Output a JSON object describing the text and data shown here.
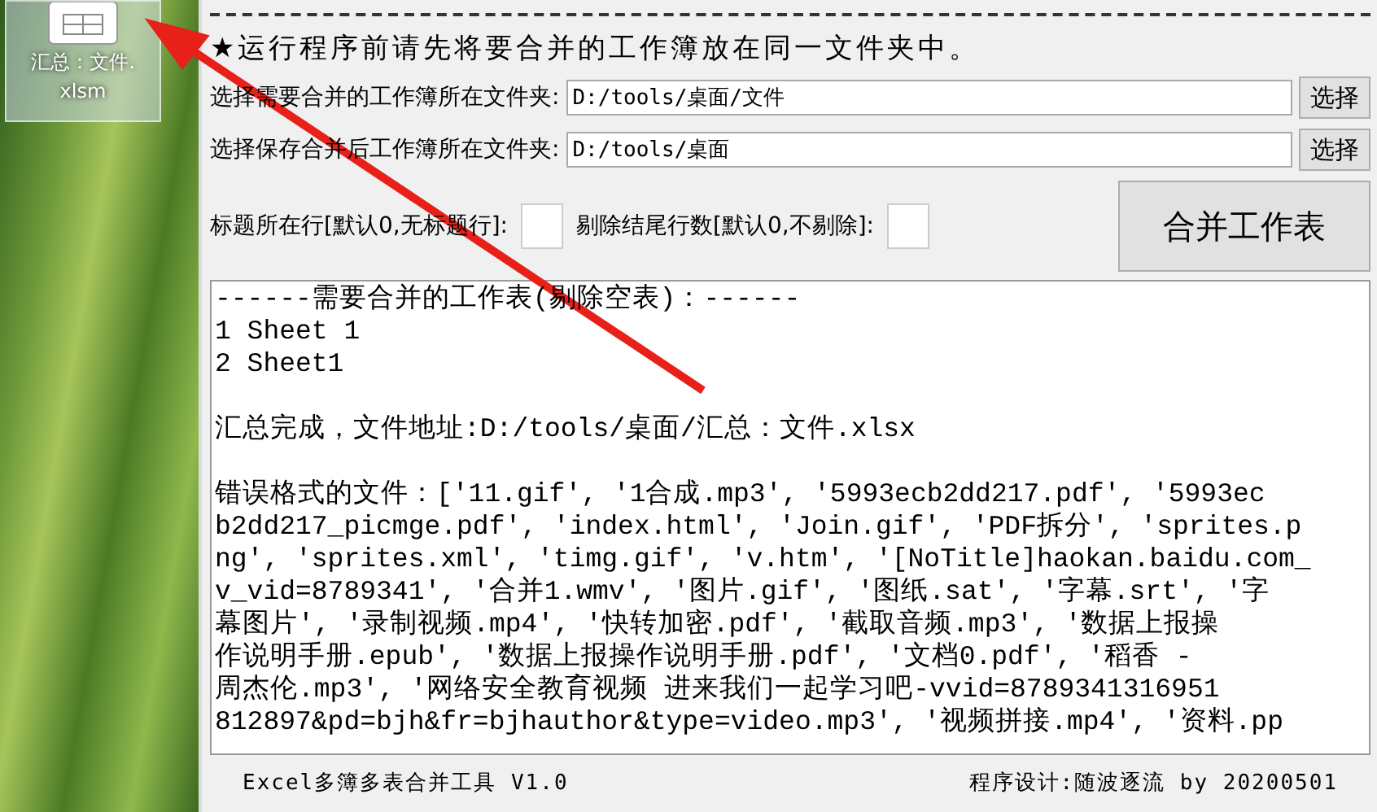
{
  "desktop": {
    "icon": {
      "label_lines": [
        "汇总：文件.",
        "xlsm"
      ],
      "selected": true
    }
  },
  "app": {
    "notice": "★运行程序前请先将要合并的工作簿放在同一文件夹中。",
    "folder_rows": [
      {
        "label": "选择需要合并的工作簿所在文件夹:",
        "value": "D:/tools/桌面/文件",
        "button": "选择"
      },
      {
        "label": "选择保存合并后工作簿所在文件夹:",
        "value": "D:/tools/桌面",
        "button": "选择"
      }
    ],
    "options": [
      {
        "label": "标题所在行[默认0,无标题行]:"
      },
      {
        "label": "剔除结尾行数[默认0,不剔除]:"
      }
    ],
    "merge_button": "合并工作表",
    "log": [
      [
        "------需要合并的工作表(剔除空表)：------",
        "1 Sheet 1",
        "2 Sheet1"
      ],
      [
        "汇总完成，文件地址:D:/tools/桌面/汇总：文件.xlsx"
      ],
      [
        "错误格式的文件：['11.gif', '1合成.mp3', '5993ecb2dd217.pdf', '5993ec",
        "b2dd217_picmge.pdf', 'index.html', 'Join.gif', 'PDF拆分', 'sprites.p",
        "ng', 'sprites.xml', 'timg.gif', 'v.htm', '[NoTitle]haokan.baidu.com_",
        "v_vid=8789341', '合并1.wmv', '图片.gif', '图纸.sat', '字幕.srt', '字",
        "幕图片', '录制视频.mp4', '快转加密.pdf', '截取音频.mp3', '数据上报操",
        "作说明手册.epub', '数据上报操作说明手册.pdf', '文档0.pdf', '稻香 -",
        "周杰伦.mp3', '网络安全教育视频 进来我们一起学习吧-vvid=8789341316951",
        "812897&pd=bjh&fr=bjhauthor&type=video.mp3', '视频拼接.mp4', '资料.pp"
      ]
    ],
    "footer": {
      "title": "Excel多簿多表合并工具 V1.0",
      "credit": "程序设计:随波逐流 by 20200501"
    }
  }
}
